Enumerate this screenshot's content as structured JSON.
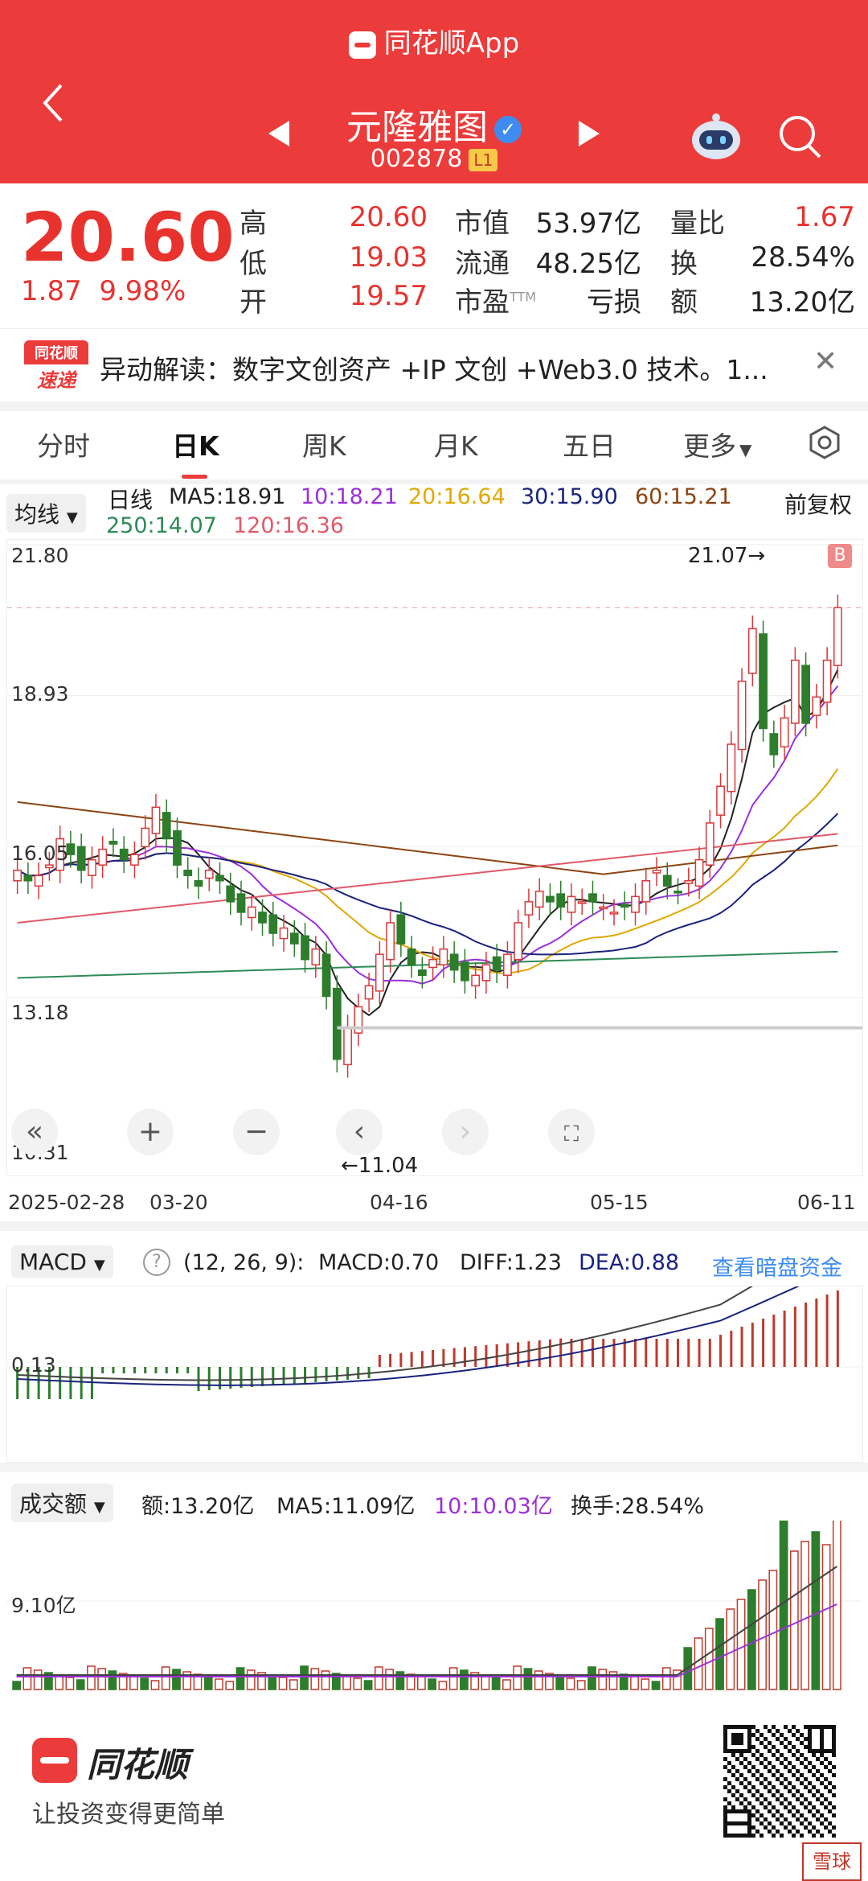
{
  "header": {
    "app_title": "同花顺App",
    "stock_name": "元隆雅图",
    "stock_code": "002878",
    "level_badge": "L1"
  },
  "quote": {
    "price": "20.60",
    "change": "1.87",
    "change_pct": "9.98%",
    "fields": [
      {
        "label": "高",
        "value": "20.60",
        "color": "red"
      },
      {
        "label": "低",
        "value": "19.03",
        "color": "red"
      },
      {
        "label": "开",
        "value": "19.57",
        "color": "red"
      }
    ],
    "mid_fields": [
      {
        "label": "市值",
        "value": "53.97亿"
      },
      {
        "label": "流通",
        "value": "48.25亿"
      },
      {
        "label": "市盈",
        "sup": "TTM",
        "value": "亏损"
      }
    ],
    "right_fields": [
      {
        "label": "量比",
        "value": "1.67",
        "color": "red"
      },
      {
        "label": "换",
        "value": "28.54%",
        "color": "black"
      },
      {
        "label": "额",
        "value": "13.20亿",
        "color": "black"
      }
    ]
  },
  "news": {
    "logo_top": "同花顺",
    "logo_bottom": "速递",
    "text": "异动解读：数字文创资产 +IP 文创 +Web3.0 技术。1..."
  },
  "tabs": [
    "分时",
    "日K",
    "周K",
    "月K",
    "五日",
    "更多"
  ],
  "active_tab": "日K",
  "kline": {
    "indicator_select": "均线",
    "period_label": "日线",
    "adjust": "前复权",
    "ma": [
      {
        "text": "MA5:18.91",
        "color": "#222222"
      },
      {
        "text": "10:18.21",
        "color": "#9b30d9"
      },
      {
        "text": "20:16.64",
        "color": "#e0a800"
      },
      {
        "text": "30:15.90",
        "color": "#1a237e"
      },
      {
        "text": "60:15.21",
        "color": "#8b4513"
      },
      {
        "text": "250:14.07",
        "color": "#2e8b57"
      },
      {
        "text": "120:16.36",
        "color": "#e05a6a"
      }
    ],
    "y_ticks": [
      "21.80",
      "18.93",
      "16.05",
      "13.18",
      "10.31"
    ],
    "high_marker": "21.07→",
    "low_marker": "←11.04",
    "b_marker": "B",
    "dates": [
      "2025-02-28",
      "03-20",
      "04-16",
      "05-15",
      "06-11"
    ]
  },
  "macd": {
    "select": "MACD",
    "params": "(12, 26, 9):",
    "macd": "MACD:0.70",
    "diff": "DIFF:1.23",
    "dea": "DEA:0.88",
    "link": "查看暗盘资金",
    "axis": "0.13"
  },
  "volume": {
    "select": "成交额",
    "amount": "额:13.20亿",
    "ma5": "MA5:11.09亿",
    "ma10": "10:10.03亿",
    "turnover": "换手:28.54%",
    "axis": "9.10亿"
  },
  "footer": {
    "brand": "同花顺",
    "slogan": "让投资变得更简单",
    "stamp": "雪球"
  },
  "chart_data": {
    "type": "candlestick",
    "x": [
      "2025-02-28",
      "03-20",
      "04-16",
      "05-15",
      "06-11"
    ],
    "ylim": [
      10.31,
      21.8
    ],
    "last_close": 20.6,
    "period_high": 21.07,
    "period_low": 11.04,
    "macd_values": {
      "MACD": 0.7,
      "DIFF": 1.23,
      "DEA": 0.88
    },
    "volume_values": {
      "amount": "13.20亿",
      "MA5": "11.09亿",
      "MA10": "10.03亿"
    }
  }
}
